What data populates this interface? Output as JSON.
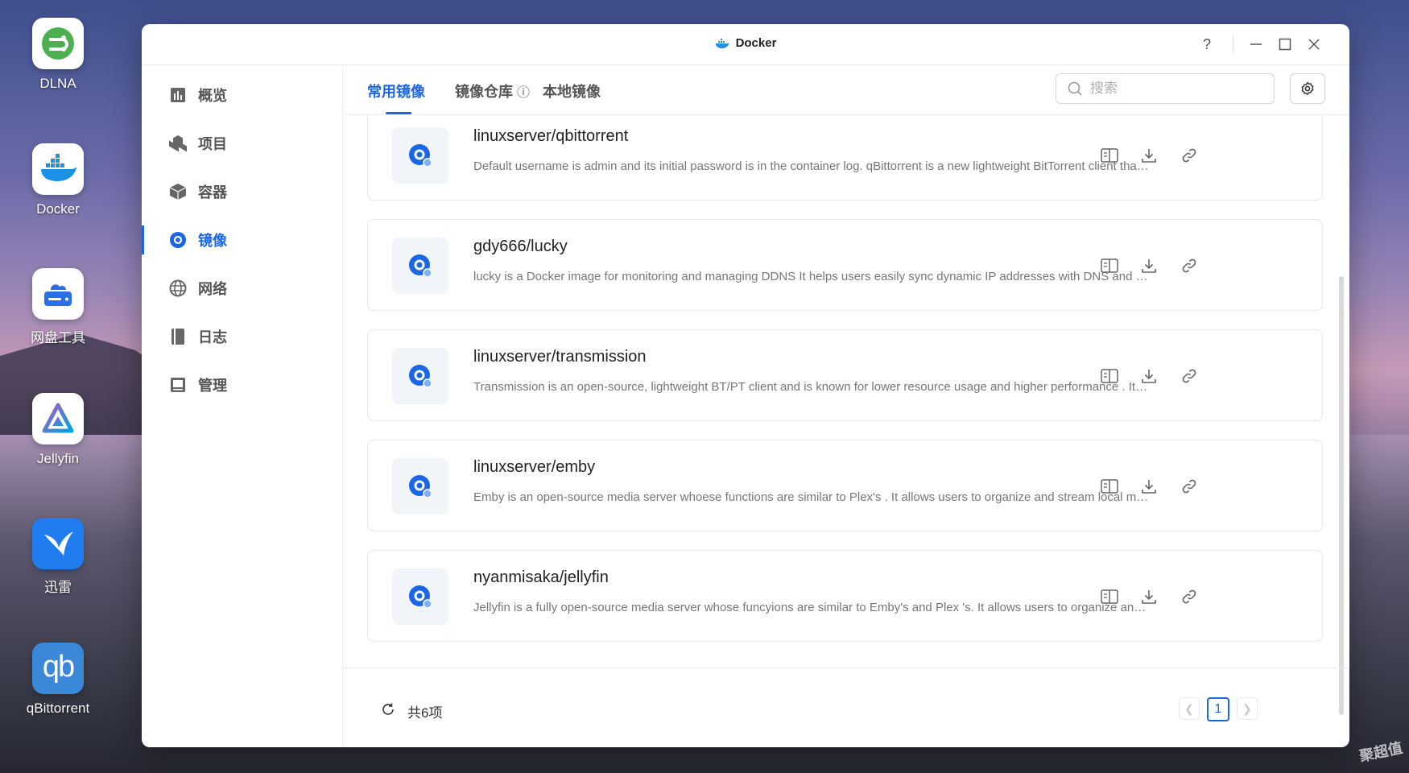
{
  "desktop": {
    "icons": [
      {
        "label": "DLNA",
        "icon": "dlna-icon"
      },
      {
        "label": "Docker",
        "icon": "docker-icon"
      },
      {
        "label": "网盘工具",
        "icon": "cloud-drive-icon"
      },
      {
        "label": "Jellyfin",
        "icon": "jellyfin-icon"
      },
      {
        "label": "迅雷",
        "icon": "thunder-icon"
      },
      {
        "label": "qBittorrent",
        "icon": "qbittorrent-icon"
      }
    ],
    "watermark": "聚超值"
  },
  "window": {
    "title": "Docker",
    "controls": {
      "help": "?"
    }
  },
  "sidebar": {
    "items": [
      {
        "label": "概览",
        "icon": "overview-icon",
        "active": false
      },
      {
        "label": "项目",
        "icon": "project-icon",
        "active": false
      },
      {
        "label": "容器",
        "icon": "container-icon",
        "active": false
      },
      {
        "label": "镜像",
        "icon": "image-icon",
        "active": true
      },
      {
        "label": "网络",
        "icon": "network-icon",
        "active": false
      },
      {
        "label": "日志",
        "icon": "log-icon",
        "active": false
      },
      {
        "label": "管理",
        "icon": "manage-icon",
        "active": false
      }
    ]
  },
  "tabs": [
    {
      "label": "常用镜像",
      "active": true
    },
    {
      "label": "镜像仓库",
      "active": false,
      "info": "ⓘ"
    },
    {
      "label": "本地镜像",
      "active": false
    }
  ],
  "search": {
    "placeholder": "搜索",
    "value": ""
  },
  "images": [
    {
      "name": "linuxserver/qbittorrent",
      "description": "Default username is admin and its initial password is in the container log. qBittorrent is a new lightweight BitTorrent client that supports multiple platforms"
    },
    {
      "name": "gdy666/lucky",
      "description": "lucky is a Docker image for monitoring and managing DDNS It helps users easily sync dynamic IP addresses with DNS and domain name records"
    },
    {
      "name": "linuxserver/transmission",
      "description": "Transmission is an open-source, lightweight BT/PT client and is known for lower resource usage and higher performance . It supports"
    },
    {
      "name": "linuxserver/emby",
      "description": "Emby is an open-source media server whoese functions are similar to Plex's . It allows users to organize and stream local media files"
    },
    {
      "name": "nyanmisaka/jellyfin",
      "description": "Jellyfin is a fully open-source media server whose funcyions are similar to Emby's and Plex 's. It allows users to organize and stream media"
    }
  ],
  "footer": {
    "total": "共6项",
    "current_page": "1"
  },
  "colors": {
    "accent": "#1a66e6"
  }
}
